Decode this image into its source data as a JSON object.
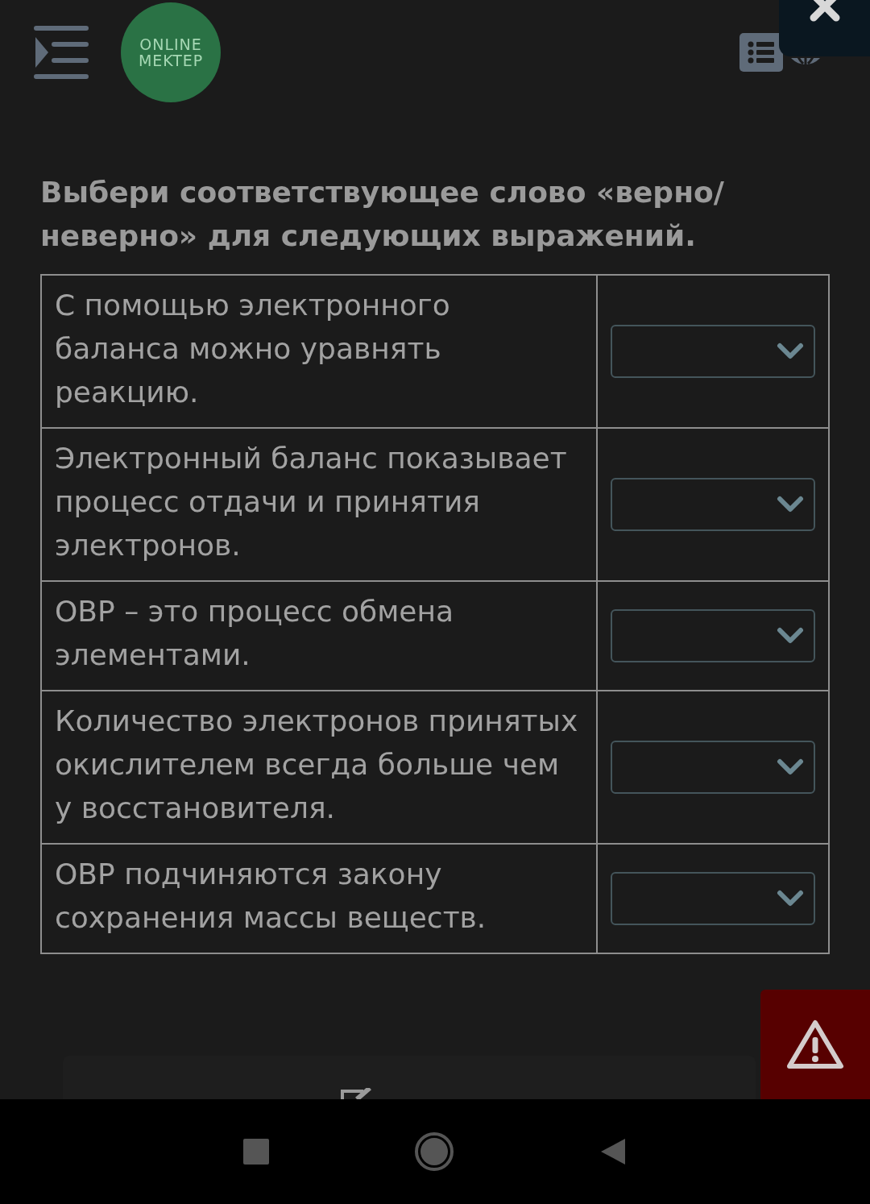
{
  "header": {
    "logo": {
      "line_1": "ONLINE",
      "line_2": "MEKTEP"
    }
  },
  "question": "Выбери соответствующее слово «верно/ неверно» для следующих выражений.",
  "rows": [
    {
      "statement": "С помощью электронного баланса можно уравнять реакцию."
    },
    {
      "statement": "Электронный баланс показывает процесс отдачи и принятия электронов."
    },
    {
      "statement": "ОВР – это процесс обмена элементами."
    },
    {
      "statement": "Количество электронов принятых окислителем всегда больше чем у восстановителя."
    },
    {
      "statement": "ОВР подчиняются закону сохранения массы веществ."
    }
  ]
}
